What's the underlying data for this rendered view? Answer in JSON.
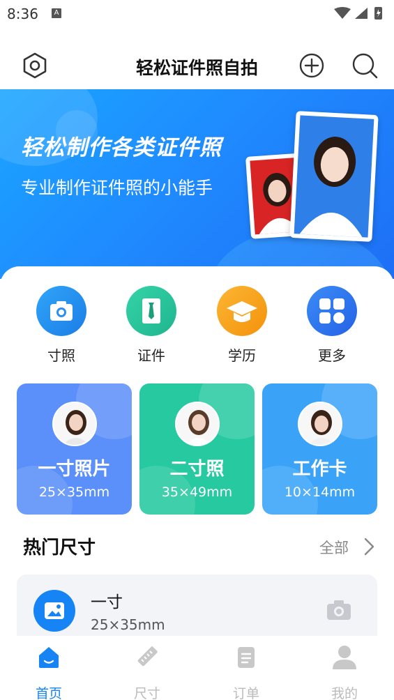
{
  "status_bar": {
    "time": "8:36",
    "a_badge": "A"
  },
  "header": {
    "title": "轻松证件照自拍",
    "icons": [
      "settings-hexagon-icon",
      "add-circle-icon",
      "search-icon"
    ]
  },
  "banner": {
    "title": "轻松制作各类证件照",
    "subtitle": "专业制作证件照的小能手"
  },
  "quick_actions": [
    {
      "label": "寸照",
      "icon": "camera-icon",
      "color": "#2b8ef3"
    },
    {
      "label": "证件",
      "icon": "id-card-icon",
      "color": "#27c49a"
    },
    {
      "label": "学历",
      "icon": "graduation-cap-icon",
      "color": "#f7a21b"
    },
    {
      "label": "更多",
      "icon": "grid-more-icon",
      "color": "#2d74f0"
    }
  ],
  "size_cards": [
    {
      "name": "一寸照片",
      "dims": "25×35mm",
      "color": "#5b8ff9"
    },
    {
      "name": "二寸照",
      "dims": "35×49mm",
      "color": "#26c9a0"
    },
    {
      "name": "工作卡",
      "dims": "10×14mm",
      "color": "#3aa3f8"
    }
  ],
  "hot_sizes": {
    "title": "热门尺寸",
    "see_all": "全部",
    "items": [
      {
        "name": "一寸",
        "dims": "25×35mm"
      }
    ]
  },
  "bottom_nav": [
    {
      "label": "首页",
      "icon": "home-icon",
      "active": true
    },
    {
      "label": "尺寸",
      "icon": "ruler-icon",
      "active": false
    },
    {
      "label": "订单",
      "icon": "order-clipboard-icon",
      "active": false
    },
    {
      "label": "我的",
      "icon": "user-icon",
      "active": false
    }
  ],
  "colors": {
    "accent": "#1684f5",
    "inactive": "#bbbbbb"
  }
}
